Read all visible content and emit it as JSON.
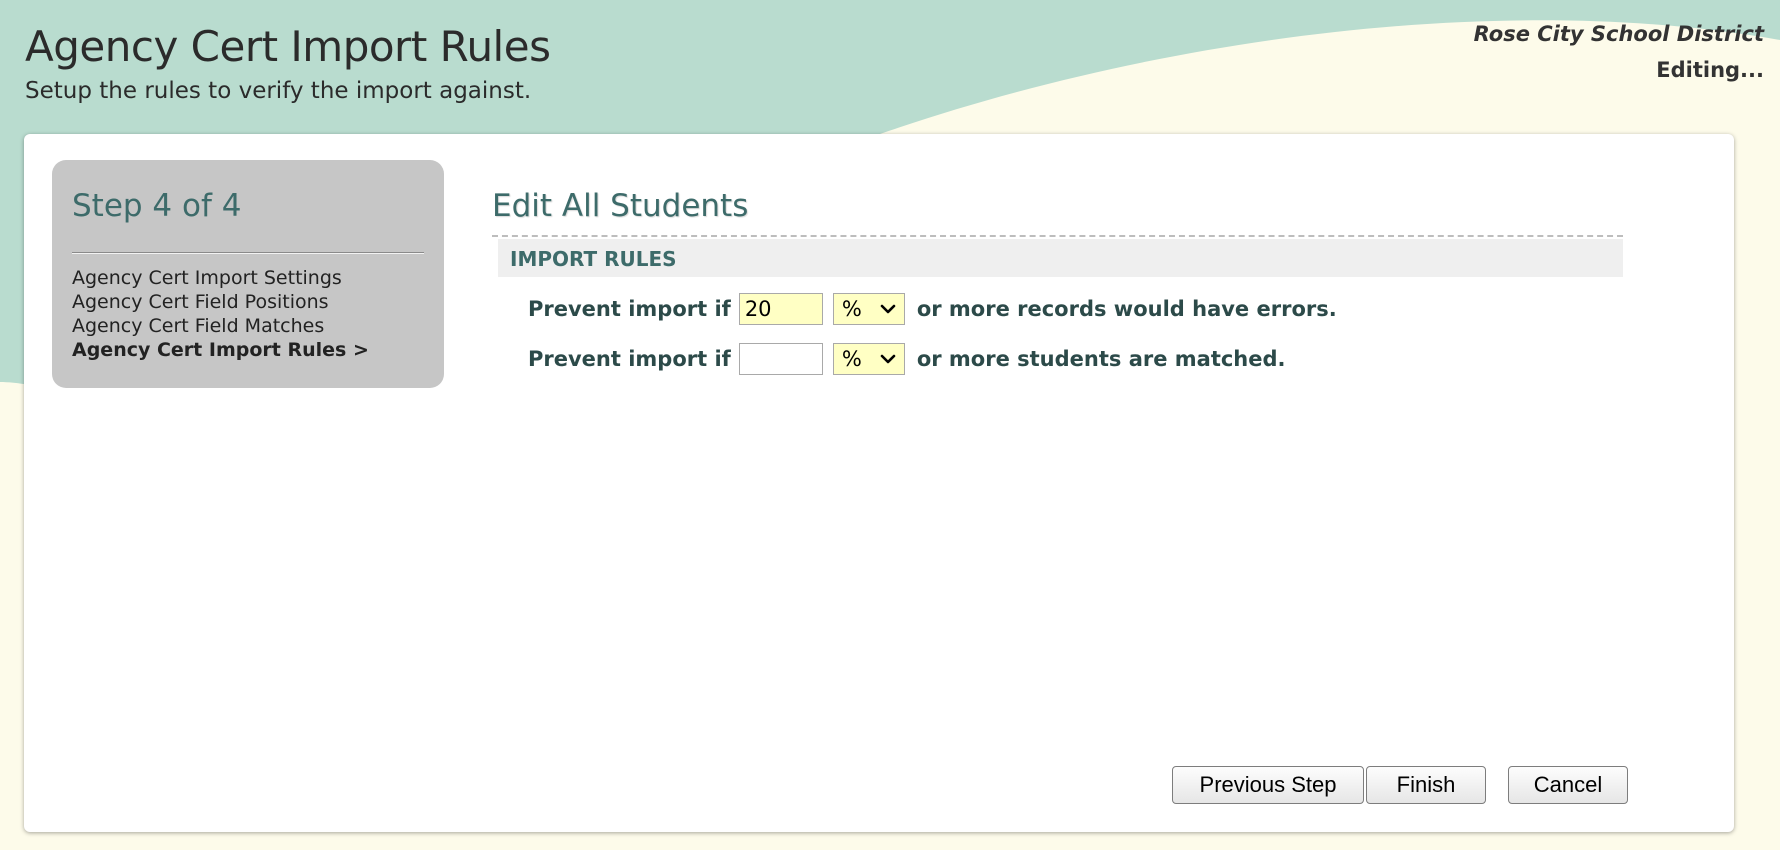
{
  "header": {
    "title": "Agency Cert Import Rules",
    "subtitle": "Setup the rules to verify the import against.",
    "district": "Rose City School District",
    "status": "Editing..."
  },
  "steps": {
    "title": "Step 4 of 4",
    "items": [
      {
        "label": "Agency Cert Import Settings",
        "current": false
      },
      {
        "label": "Agency Cert Field Positions",
        "current": false
      },
      {
        "label": "Agency Cert Field Matches",
        "current": false
      },
      {
        "label": "Agency Cert Import Rules >",
        "current": true
      }
    ]
  },
  "content": {
    "title": "Edit All Students",
    "section_header": "IMPORT RULES",
    "rules": [
      {
        "label": "Prevent import if",
        "value": "20",
        "unit": "%",
        "suffix": "or more records would have errors."
      },
      {
        "label": "Prevent import if",
        "value": "",
        "unit": "%",
        "suffix": "or more students are matched."
      }
    ]
  },
  "buttons": {
    "previous": "Previous Step",
    "finish": "Finish",
    "cancel": "Cancel"
  },
  "colors": {
    "header_wave": "#b9dccf",
    "background": "#fdfbea",
    "accent_text": "#3d6b6a",
    "input_highlight": "#ffffc4"
  }
}
